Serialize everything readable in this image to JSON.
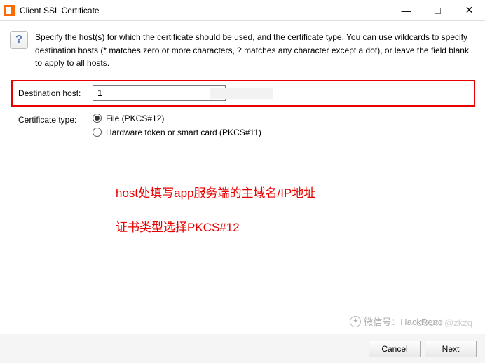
{
  "window": {
    "title": "Client SSL Certificate"
  },
  "description": "Specify the host(s) for which the certificate should be used, and the certificate type. You can use wildcards to specify destination hosts (* matches zero or more characters, ? matches any character except a dot), or leave the field blank to apply to all hosts.",
  "form": {
    "host_label": "Destination host:",
    "host_value": "1",
    "cert_type_label": "Certificate type:",
    "radio_file": "File (PKCS#12)",
    "radio_hardware": "Hardware token or smart card (PKCS#11)"
  },
  "annotations": {
    "line1": "host处填写app服务端的主域名/IP地址",
    "line2": "证书类型选择PKCS#12"
  },
  "buttons": {
    "cancel": "Cancel",
    "next": "Next"
  },
  "watermark": {
    "wechat": "微信号：HackRead",
    "csdn": "CSDN @zkzq"
  }
}
